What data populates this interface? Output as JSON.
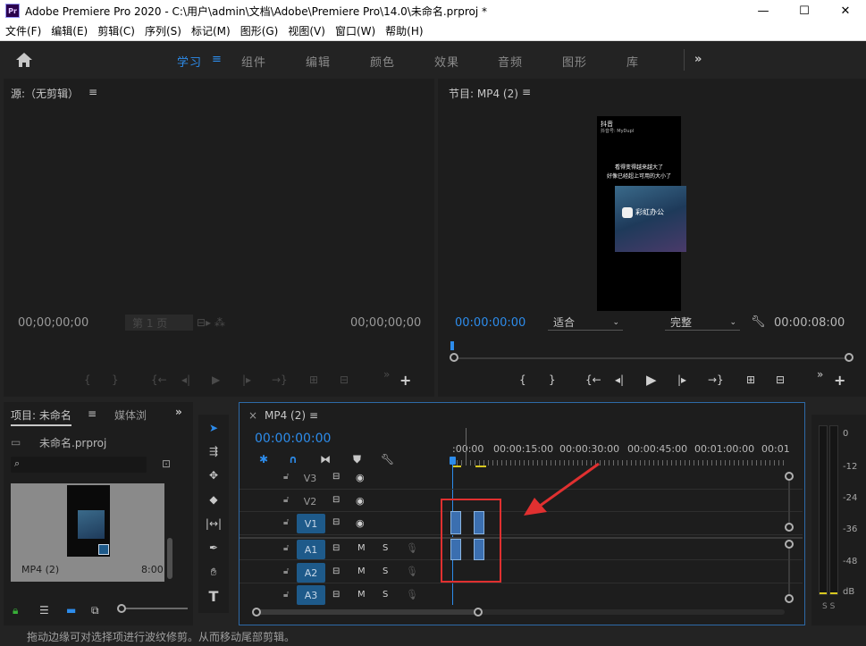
{
  "window": {
    "app_icon": "Pr",
    "title": "Adobe Premiere Pro 2020 - C:\\用户\\admin\\文档\\Adobe\\Premiere Pro\\14.0\\未命名.prproj *",
    "minimize": "—",
    "maximize": "☐",
    "close": "✕"
  },
  "menu": [
    "文件(F)",
    "编辑(E)",
    "剪辑(C)",
    "序列(S)",
    "标记(M)",
    "图形(G)",
    "视图(V)",
    "窗口(W)",
    "帮助(H)"
  ],
  "workspaces": {
    "items": [
      "学习",
      "组件",
      "编辑",
      "颜色",
      "效果",
      "音频",
      "图形",
      "库"
    ],
    "active_index": 0,
    "menu_glyph": "≡",
    "more_glyph": "»"
  },
  "source_monitor": {
    "title": "源:（无剪辑）",
    "menu_glyph": "≡",
    "timecode_left": "00;00;00;00",
    "page_label": "第 1 页",
    "timecode_right": "00;00;00;00"
  },
  "program_monitor": {
    "title": "节目: MP4 (2)",
    "menu_glyph": "≡",
    "timecode_current": "00:00:00:00",
    "fit_value": "适合",
    "quality_value": "完整",
    "timecode_duration": "00:00:08:00",
    "video_overlay": {
      "brand": "抖音",
      "user": "抖音号: MyDupl",
      "line1": "看得变得越来越大了",
      "line2": "好像已经超上可用的大小了",
      "app_name": "彩虹办公"
    }
  },
  "project_panel": {
    "tab_project": "项目: 未命名",
    "tab_media": "媒体浏",
    "menu_glyph": "≡",
    "more_glyph": "»",
    "file_name": "未命名.prproj",
    "clip_name": "MP4 (2)",
    "clip_duration": "8:00"
  },
  "timeline": {
    "close_glyph": "×",
    "sequence_tab": "MP4 (2)",
    "menu_glyph": "≡",
    "timecode": "00:00:00:00",
    "ruler_labels": [
      ":00:00",
      "00:00:15:00",
      "00:00:30:00",
      "00:00:45:00",
      "00:01:00:00",
      "00:01"
    ],
    "video_tracks": [
      "V3",
      "V2",
      "V1"
    ],
    "audio_tracks": [
      "A1",
      "A2",
      "A3"
    ],
    "mute_label": "M",
    "solo_label": "S"
  },
  "audio_meter": {
    "scale": [
      "0",
      "-12",
      "-24",
      "-36",
      "-48",
      "dB"
    ],
    "solo_glyphs": "S S"
  },
  "status_bar": {
    "message": "拖动边缘可对选择项进行波纹修剪。从而移动尾部剪辑。"
  },
  "colors": {
    "accent_blue": "#2d8ceb",
    "annotation_red": "#e03030",
    "track_blue": "#1e5a8a"
  }
}
